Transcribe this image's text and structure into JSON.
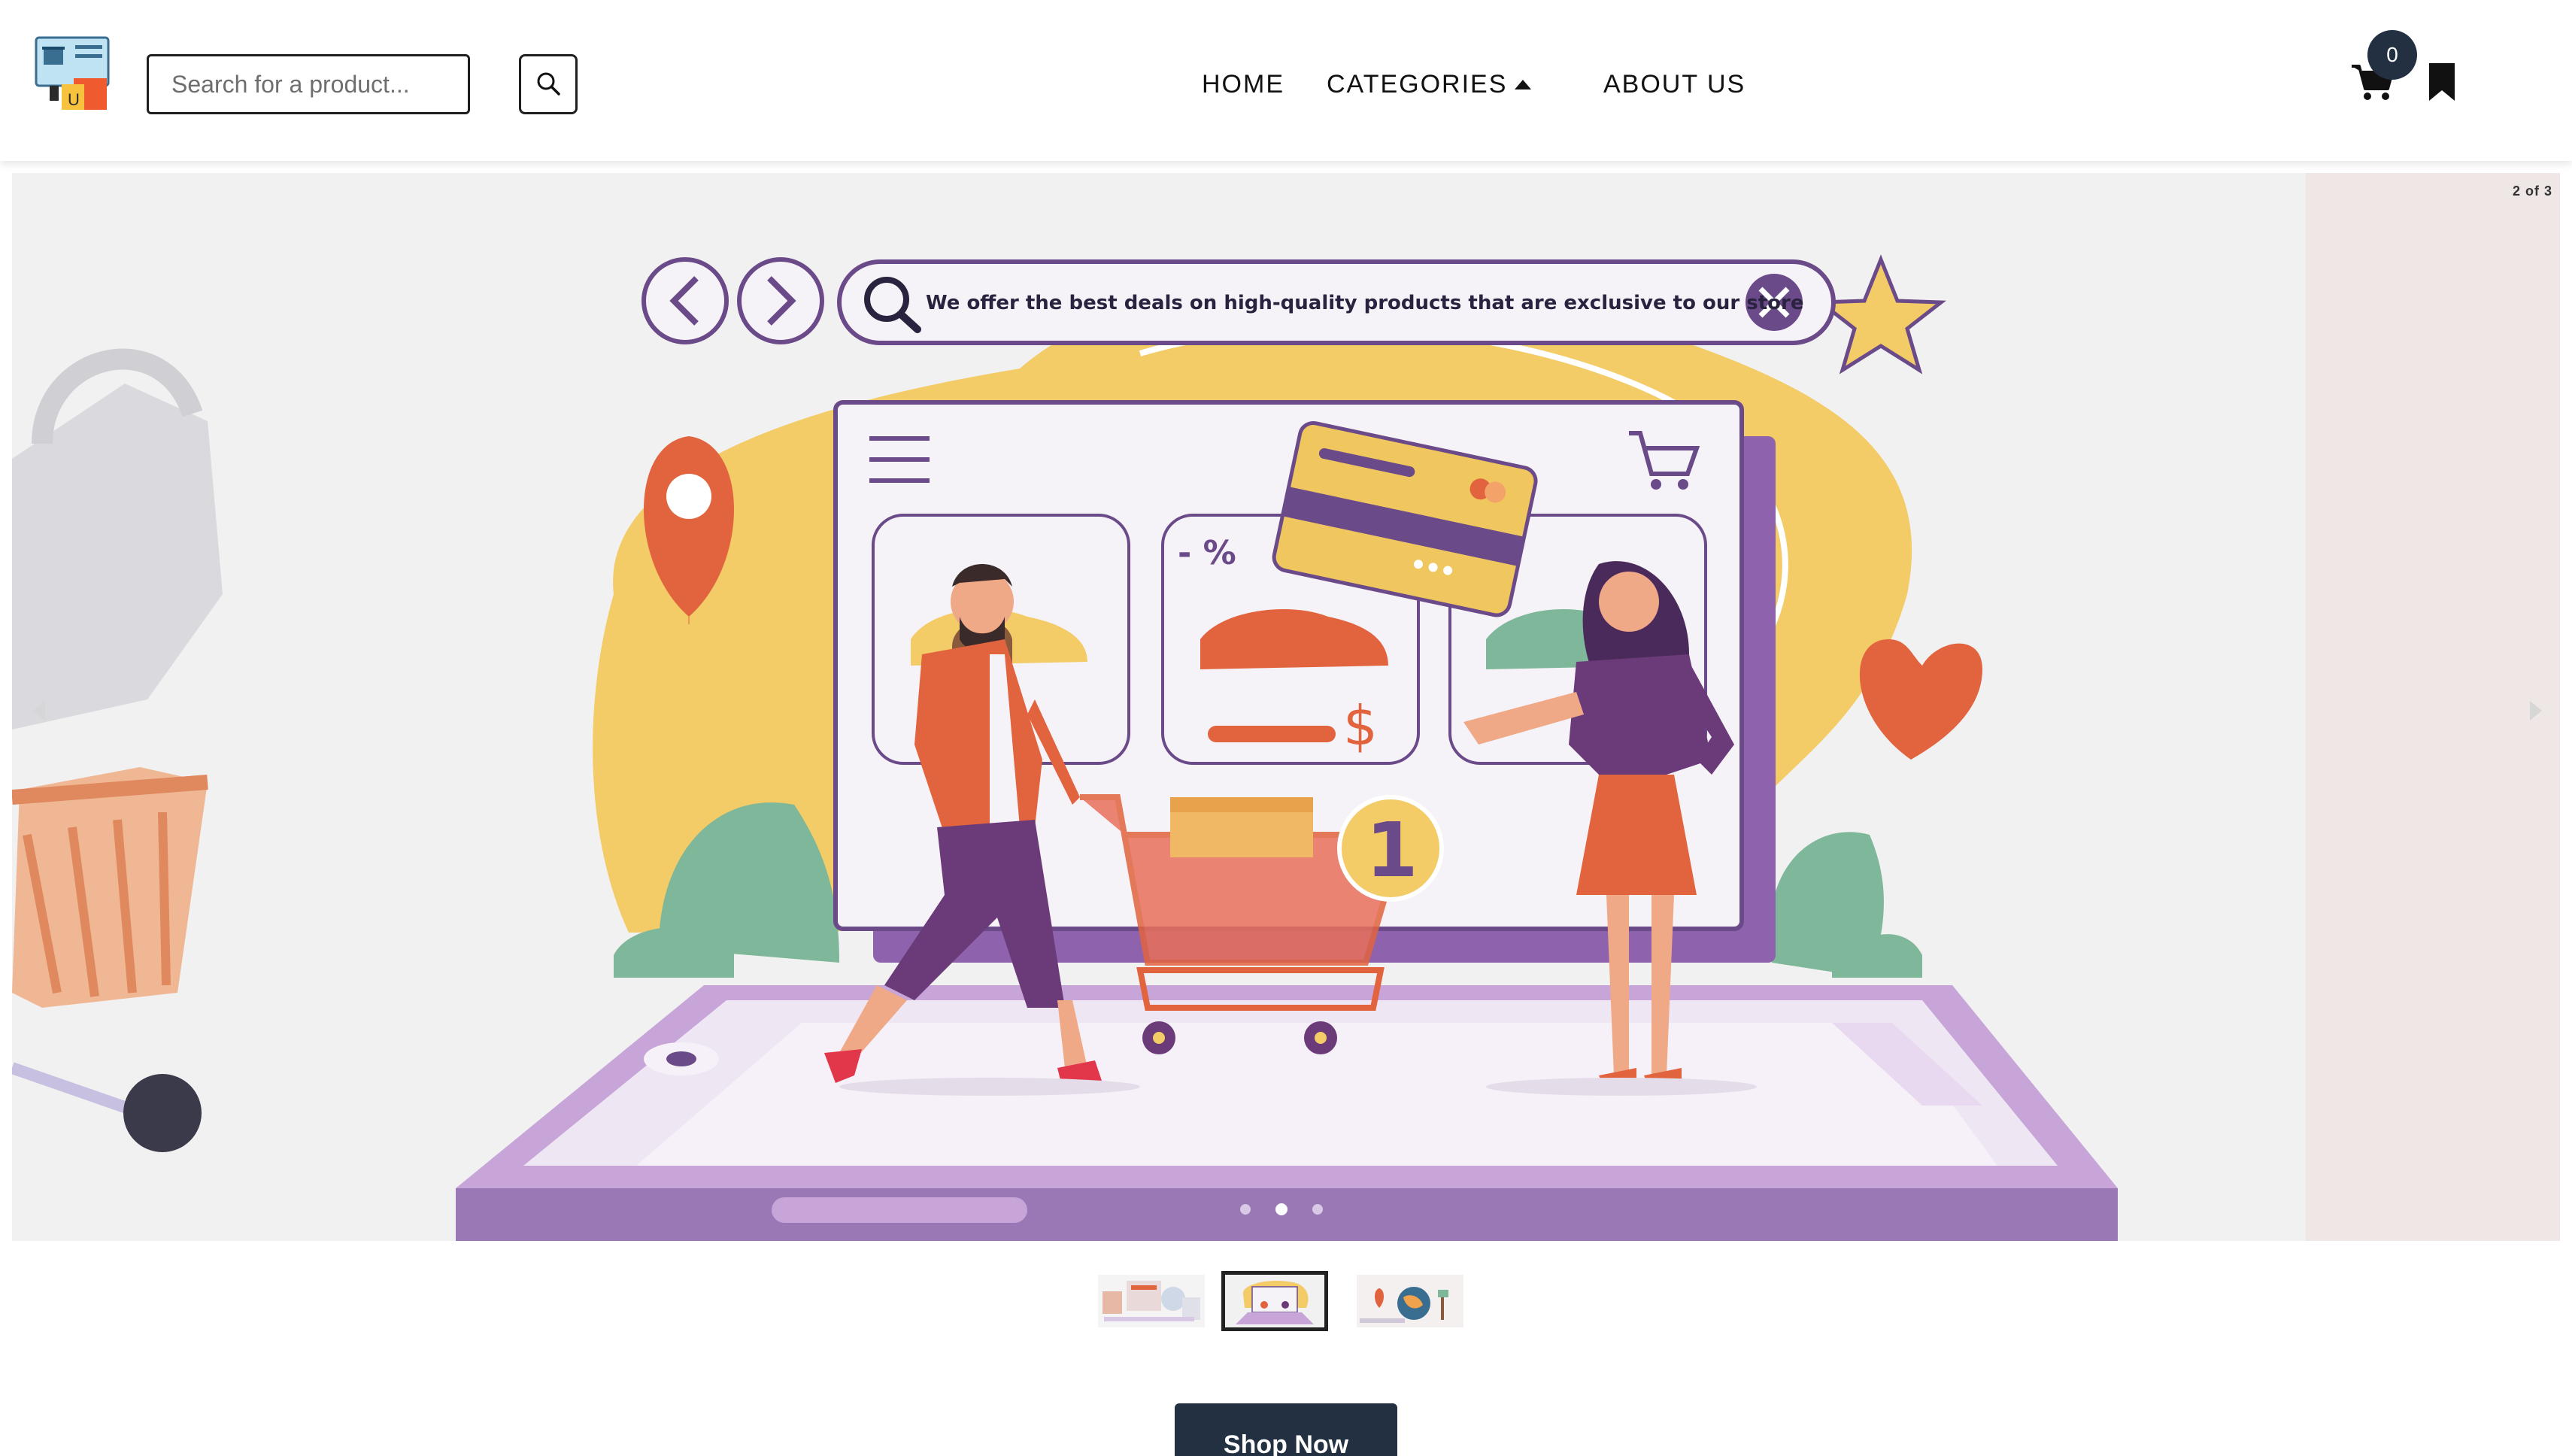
{
  "navbar": {
    "search_placeholder": "Search for a product...",
    "links": [
      {
        "label": "HOME"
      },
      {
        "label": "CATEGORIES"
      },
      {
        "label": "ABOUT US"
      }
    ],
    "cart_count": "0"
  },
  "carousel": {
    "counter": "2 of 3",
    "current_slide": 2,
    "total_slides": 3,
    "banner_text": "We offer the best deals on high-quality products that are exclusive to our store",
    "discount_label": "- %",
    "price_symbol": "$",
    "badge_number": "1"
  },
  "cta": {
    "label": "Shop Now"
  },
  "colors": {
    "dark": "#223042",
    "purple": "#7a4f96",
    "yellow": "#f0c75e",
    "orange": "#e2643f",
    "lavender": "#c7a5d8",
    "green": "#7fb79a"
  },
  "icons": [
    "logo-icon",
    "search-icon",
    "caret-up-icon",
    "cart-icon",
    "bookmark-icon",
    "chevron-left-icon",
    "chevron-right-icon"
  ]
}
